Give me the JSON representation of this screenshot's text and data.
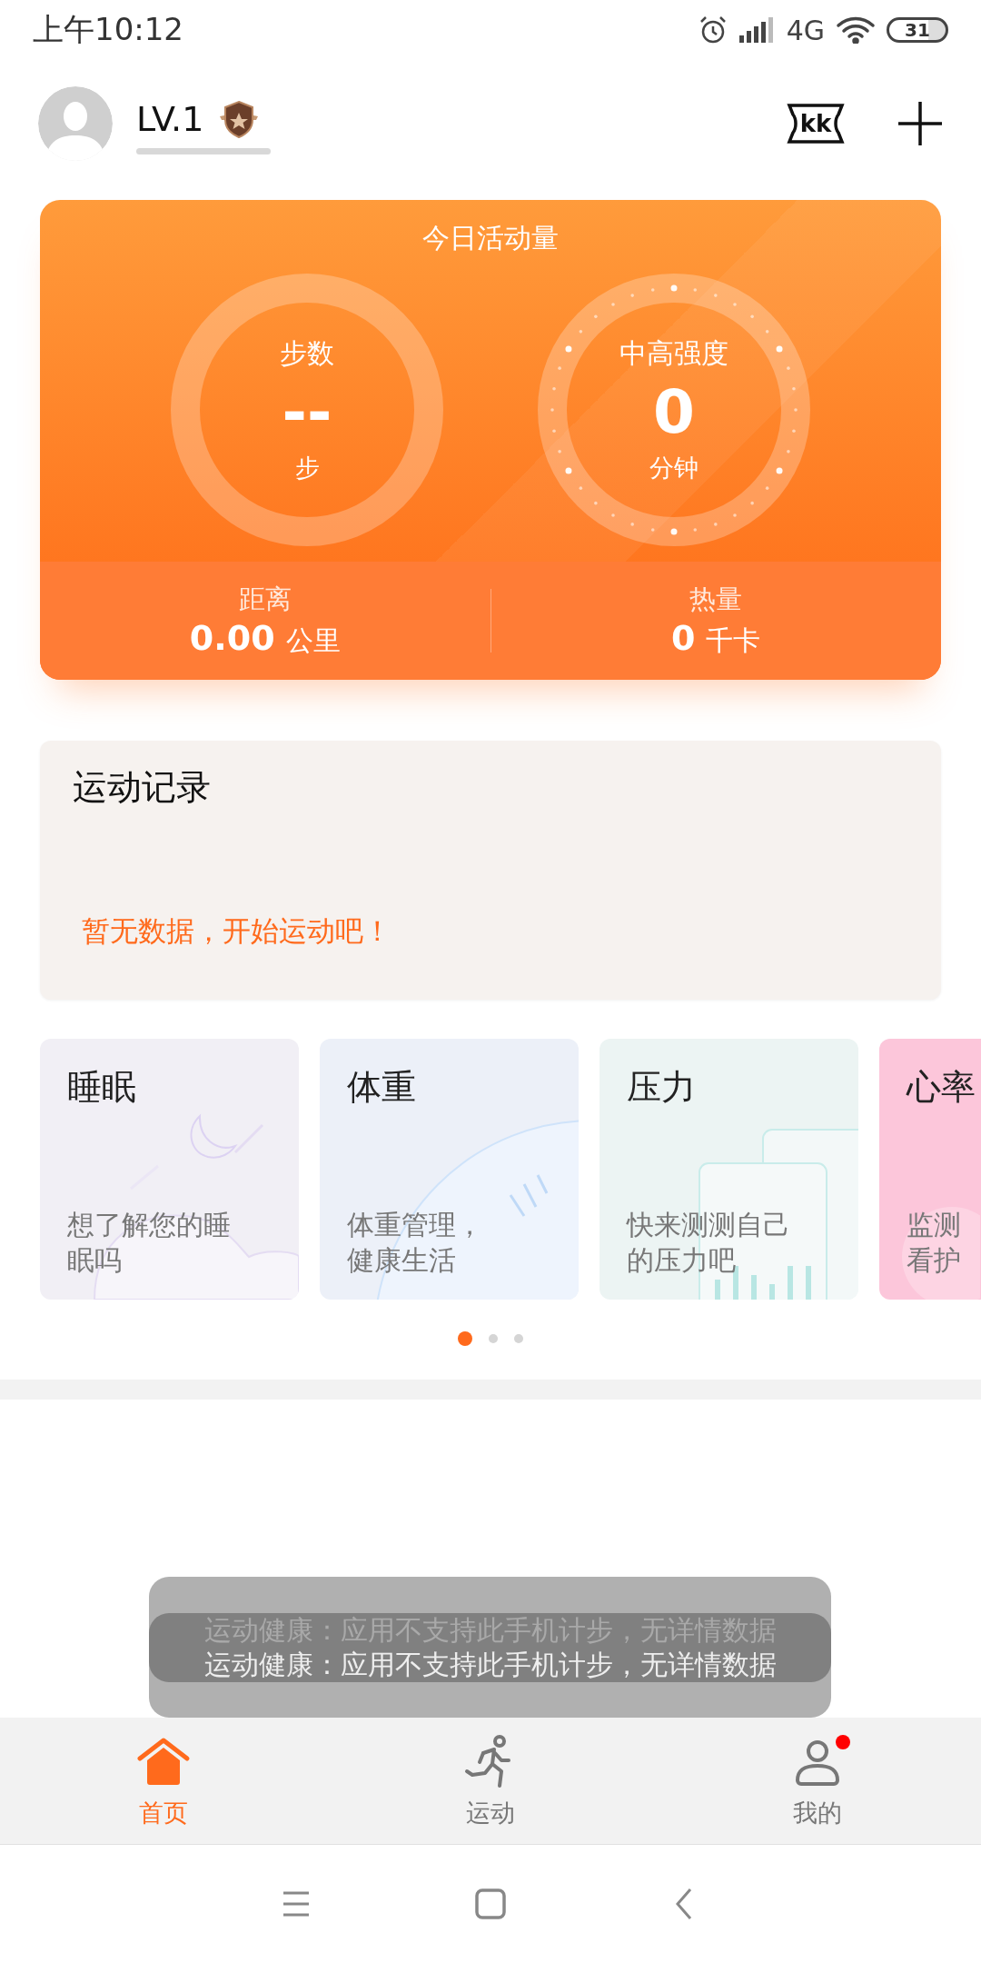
{
  "status_bar": {
    "time": "上午10:12",
    "network": "4G",
    "battery": "31"
  },
  "header": {
    "level_label": "LV.1",
    "ticket_label": "kk"
  },
  "activity": {
    "title": "今日活动量",
    "rings": [
      {
        "kind": "plain",
        "label": "步数",
        "value": "--",
        "unit": "步"
      },
      {
        "kind": "dotted",
        "label": "中高强度",
        "value": "0",
        "unit": "分钟"
      }
    ],
    "stats": [
      {
        "label": "距离",
        "value": "0.00",
        "unit": "公里"
      },
      {
        "label": "热量",
        "value": "0",
        "unit": "千卡"
      }
    ]
  },
  "records": {
    "title": "运动记录",
    "empty_message": "暂无数据，开始运动吧！"
  },
  "health_cards": [
    {
      "kind": "sleep",
      "title": "睡眠",
      "lines": [
        "想了解您的睡",
        "眠吗"
      ],
      "color": "#f1eff5"
    },
    {
      "kind": "weight",
      "title": "体重",
      "lines": [
        "体重管理，",
        "健康生活"
      ],
      "color": "#ecf0f8"
    },
    {
      "kind": "stress",
      "title": "压力",
      "lines": [
        "快来测测自己",
        "的压力吧"
      ],
      "color": "#ecf4f3"
    },
    {
      "kind": "heart",
      "title": "心率",
      "lines": [
        "监测",
        "看护"
      ],
      "color": "#fcc6da"
    }
  ],
  "pager": [
    {
      "selected": true
    },
    {
      "selected": false
    },
    {
      "selected": false
    }
  ],
  "toast": {
    "messages": [
      {
        "text": "运动健康：应用不支持此手机计步，无详情数据",
        "faded": true
      },
      {
        "text": "运动健康：应用不支持此手机计步，无详情数据",
        "faded": false
      }
    ]
  },
  "tab_bar": [
    {
      "kind": "home",
      "label": "首页",
      "selected": true,
      "badge": false
    },
    {
      "kind": "sport",
      "label": "运动",
      "selected": false,
      "badge": false
    },
    {
      "kind": "me",
      "label": "我的",
      "selected": false,
      "badge": true
    }
  ]
}
